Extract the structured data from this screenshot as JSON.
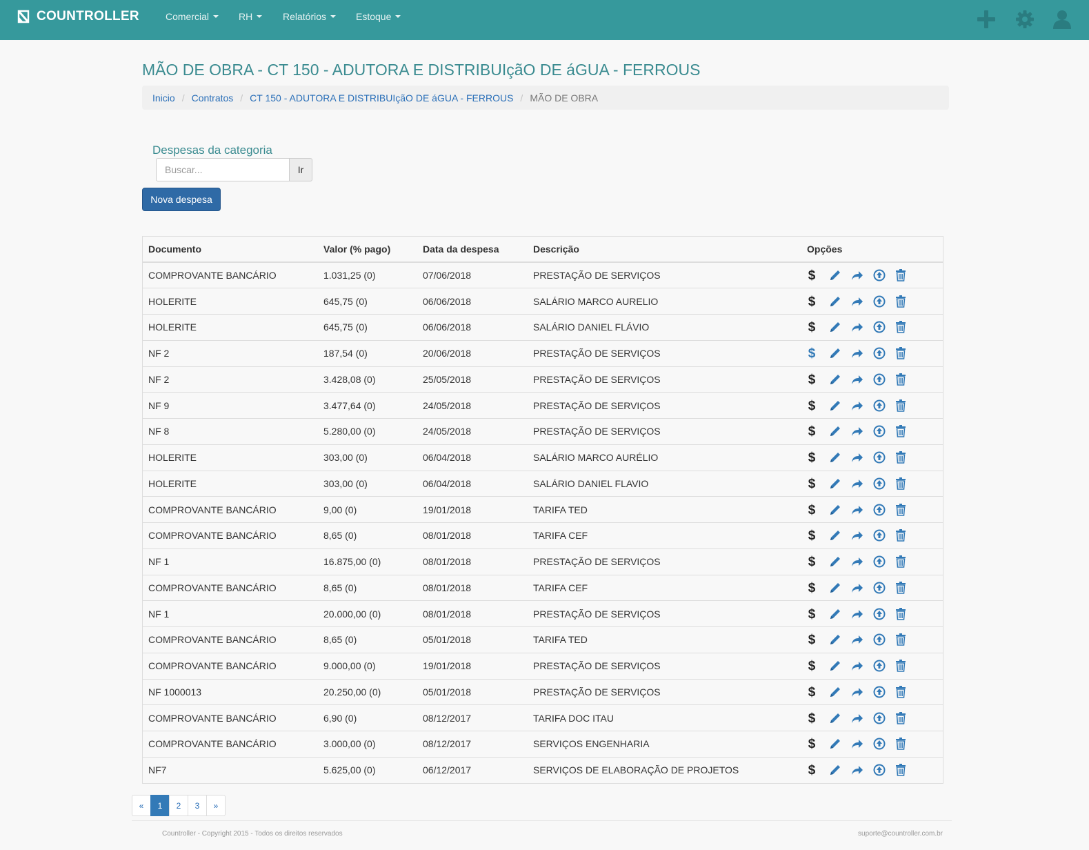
{
  "app": {
    "brand": "COUNTROLLER",
    "menu": [
      {
        "label": "Comercial"
      },
      {
        "label": "RH"
      },
      {
        "label": "Relatórios"
      },
      {
        "label": "Estoque"
      }
    ],
    "nav_icons": [
      "plus-icon",
      "gear-icon",
      "user-icon"
    ]
  },
  "page": {
    "title": "MÃO DE OBRA - CT 150 - ADUTORA E DISTRIBUIçãO DE áGUA - FERROUS",
    "breadcrumb": {
      "home": "Inicio",
      "contracts": "Contratos",
      "contract": "CT 150 - ADUTORA E DISTRIBUIçãO DE áGUA - FERROUS",
      "current": "MÃO DE OBRA"
    }
  },
  "expenses": {
    "section_title": "Despesas da categoria",
    "search_placeholder": "Buscar...",
    "search_button": "Ir",
    "new_button": "Nova despesa",
    "columns": {
      "doc": "Documento",
      "value": "Valor (% pago)",
      "date": "Data da despesa",
      "description": "Descrição",
      "options": "Opções"
    },
    "rows": [
      {
        "doc": "COMPROVANTE BANCÁRIO",
        "value": "1.031,25 (0)",
        "date": "07/06/2018",
        "description": "PRESTAÇÃO DE SERVIÇOS",
        "dollar_color": "#222222"
      },
      {
        "doc": "HOLERITE",
        "value": "645,75 (0)",
        "date": "06/06/2018",
        "description": "SALÁRIO MARCO AURELIO",
        "dollar_color": "#222222"
      },
      {
        "doc": "HOLERITE",
        "value": "645,75 (0)",
        "date": "06/06/2018",
        "description": "SALÁRIO DANIEL FLÁVIO",
        "dollar_color": "#222222"
      },
      {
        "doc": "NF 2",
        "value": "187,54 (0)",
        "date": "20/06/2018",
        "description": "PRESTAÇÃO DE SERVIÇOS",
        "dollar_color": "#337ab7"
      },
      {
        "doc": "NF 2",
        "value": "3.428,08 (0)",
        "date": "25/05/2018",
        "description": "PRESTAÇÃO DE SERVIÇOS",
        "dollar_color": "#222222"
      },
      {
        "doc": "NF 9",
        "value": "3.477,64 (0)",
        "date": "24/05/2018",
        "description": "PRESTAÇÃO DE SERVIÇOS",
        "dollar_color": "#222222"
      },
      {
        "doc": "NF 8",
        "value": "5.280,00 (0)",
        "date": "24/05/2018",
        "description": "PRESTAÇÃO DE SERVIÇOS",
        "dollar_color": "#222222"
      },
      {
        "doc": "HOLERITE",
        "value": "303,00 (0)",
        "date": "06/04/2018",
        "description": "SALÁRIO MARCO AURÉLIO",
        "dollar_color": "#222222"
      },
      {
        "doc": "HOLERITE",
        "value": "303,00 (0)",
        "date": "06/04/2018",
        "description": "SALÁRIO DANIEL FLAVIO",
        "dollar_color": "#222222"
      },
      {
        "doc": "COMPROVANTE BANCÁRIO",
        "value": "9,00 (0)",
        "date": "19/01/2018",
        "description": "TARIFA TED",
        "dollar_color": "#222222"
      },
      {
        "doc": "COMPROVANTE BANCÁRIO",
        "value": "8,65 (0)",
        "date": "08/01/2018",
        "description": "TARIFA CEF",
        "dollar_color": "#222222"
      },
      {
        "doc": "NF 1",
        "value": "16.875,00 (0)",
        "date": "08/01/2018",
        "description": "PRESTAÇÃO DE SERVIÇOS",
        "dollar_color": "#222222"
      },
      {
        "doc": "COMPROVANTE BANCÁRIO",
        "value": "8,65 (0)",
        "date": "08/01/2018",
        "description": "TARIFA CEF",
        "dollar_color": "#222222"
      },
      {
        "doc": "NF 1",
        "value": "20.000,00 (0)",
        "date": "08/01/2018",
        "description": "PRESTAÇÃO DE SERVIÇOS",
        "dollar_color": "#222222"
      },
      {
        "doc": "COMPROVANTE BANCÁRIO",
        "value": "8,65 (0)",
        "date": "05/01/2018",
        "description": "TARIFA TED",
        "dollar_color": "#222222"
      },
      {
        "doc": "COMPROVANTE BANCÁRIO",
        "value": "9.000,00 (0)",
        "date": "19/01/2018",
        "description": "PRESTAÇÃO DE SERVIÇOS",
        "dollar_color": "#222222"
      },
      {
        "doc": "NF 1000013",
        "value": "20.250,00 (0)",
        "date": "05/01/2018",
        "description": "PRESTAÇÃO DE SERVIÇOS",
        "dollar_color": "#222222"
      },
      {
        "doc": "COMPROVANTE BANCÁRIO",
        "value": "6,90 (0)",
        "date": "08/12/2017",
        "description": "TARIFA DOC ITAU",
        "dollar_color": "#222222"
      },
      {
        "doc": "COMPROVANTE BANCÁRIO",
        "value": "3.000,00 (0)",
        "date": "08/12/2017",
        "description": "SERVIÇOS ENGENHARIA",
        "dollar_color": "#222222"
      },
      {
        "doc": "NF7",
        "value": "5.625,00 (0)",
        "date": "06/12/2017",
        "description": "SERVIÇOS DE ELABORAÇÃO DE PROJETOS",
        "dollar_color": "#222222"
      }
    ],
    "row_option_icons": [
      "dollar-icon",
      "pencil-icon",
      "share-icon",
      "upload-icon",
      "trash-icon"
    ]
  },
  "pagination": {
    "prev": "«",
    "pages": [
      "1",
      "2",
      "3"
    ],
    "current": "1",
    "next": "»"
  },
  "footer": {
    "copyright": "Countroller - Copyright 2015 - Todos os direitos reservados",
    "email": "suporte@countroller.com.br"
  },
  "colors": {
    "navbar": "#36999c",
    "title": "#3a8b90",
    "link": "#2a6fb8",
    "primary_button": "#2f6aa6",
    "icon_blue": "#337ab7"
  }
}
